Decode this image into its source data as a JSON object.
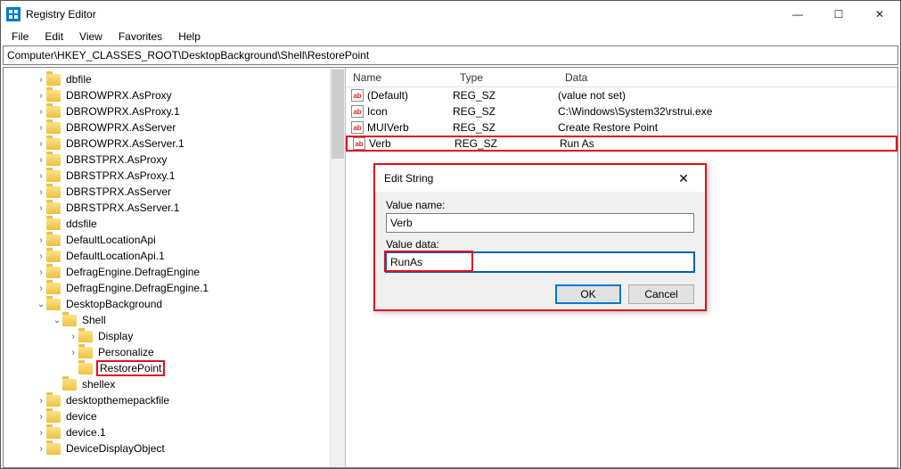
{
  "window": {
    "title": "Registry Editor",
    "controls": {
      "min": "—",
      "max": "☐",
      "close": "✕"
    }
  },
  "menubar": [
    "File",
    "Edit",
    "View",
    "Favorites",
    "Help"
  ],
  "address": "Computer\\HKEY_CLASSES_ROOT\\DesktopBackground\\Shell\\RestorePoint",
  "tree": [
    {
      "indent": 2,
      "exp": "closed",
      "label": "dbfile"
    },
    {
      "indent": 2,
      "exp": "closed",
      "label": "DBROWPRX.AsProxy"
    },
    {
      "indent": 2,
      "exp": "closed",
      "label": "DBROWPRX.AsProxy.1"
    },
    {
      "indent": 2,
      "exp": "closed",
      "label": "DBROWPRX.AsServer"
    },
    {
      "indent": 2,
      "exp": "closed",
      "label": "DBROWPRX.AsServer.1"
    },
    {
      "indent": 2,
      "exp": "closed",
      "label": "DBRSTPRX.AsProxy"
    },
    {
      "indent": 2,
      "exp": "closed",
      "label": "DBRSTPRX.AsProxy.1"
    },
    {
      "indent": 2,
      "exp": "closed",
      "label": "DBRSTPRX.AsServer"
    },
    {
      "indent": 2,
      "exp": "closed",
      "label": "DBRSTPRX.AsServer.1"
    },
    {
      "indent": 2,
      "exp": "none",
      "label": "ddsfile"
    },
    {
      "indent": 2,
      "exp": "closed",
      "label": "DefaultLocationApi"
    },
    {
      "indent": 2,
      "exp": "closed",
      "label": "DefaultLocationApi.1"
    },
    {
      "indent": 2,
      "exp": "closed",
      "label": "DefragEngine.DefragEngine"
    },
    {
      "indent": 2,
      "exp": "closed",
      "label": "DefragEngine.DefragEngine.1"
    },
    {
      "indent": 2,
      "exp": "open",
      "label": "DesktopBackground"
    },
    {
      "indent": 3,
      "exp": "open",
      "label": "Shell"
    },
    {
      "indent": 4,
      "exp": "closed",
      "label": "Display"
    },
    {
      "indent": 4,
      "exp": "closed",
      "label": "Personalize"
    },
    {
      "indent": 4,
      "exp": "none",
      "label": "RestorePoint",
      "highlight": true
    },
    {
      "indent": 3,
      "exp": "none",
      "label": "shellex"
    },
    {
      "indent": 2,
      "exp": "closed",
      "label": "desktopthemepackfile"
    },
    {
      "indent": 2,
      "exp": "closed",
      "label": "device"
    },
    {
      "indent": 2,
      "exp": "closed",
      "label": "device.1"
    },
    {
      "indent": 2,
      "exp": "closed",
      "label": "DeviceDisplayObject"
    }
  ],
  "columns": {
    "name": "Name",
    "type": "Type",
    "data": "Data"
  },
  "values": [
    {
      "name": "(Default)",
      "type": "REG_SZ",
      "data": "(value not set)"
    },
    {
      "name": "Icon",
      "type": "REG_SZ",
      "data": "C:\\Windows\\System32\\rstrui.exe"
    },
    {
      "name": "MUIVerb",
      "type": "REG_SZ",
      "data": "Create Restore Point"
    },
    {
      "name": "Verb",
      "type": "REG_SZ",
      "data": "Run As",
      "highlight": true
    }
  ],
  "dialog": {
    "title": "Edit String",
    "name_label": "Value name:",
    "name_value": "Verb",
    "data_label": "Value data:",
    "data_value": "RunAs",
    "ok": "OK",
    "cancel": "Cancel"
  }
}
